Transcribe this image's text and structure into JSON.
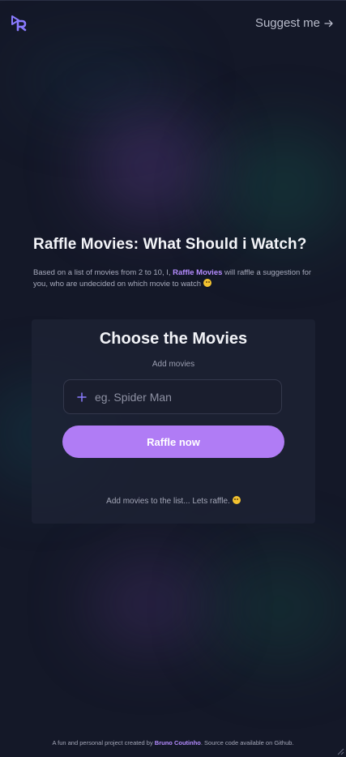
{
  "header": {
    "logo_icon": "raffle-logo",
    "suggest_label": "Suggest me",
    "arrow_icon": "arrow-right-icon"
  },
  "hero": {
    "title": "Raffle Movies: What Should i Watch?",
    "desc_before": "Based on a list of movies from 2 to 10, I, ",
    "brand": "Raffle Movies",
    "desc_after": " will raffle a suggestion for you, who are undecided on which movie to watch",
    "emoji": "grinning-face-emoji"
  },
  "card": {
    "title": "Choose the Movies",
    "add_label": "Add movies",
    "input_placeholder": "eg. Spider Man",
    "input_value": "",
    "plus_icon": "plus-icon",
    "button_label": "Raffle now",
    "empty_message": "Add movies to the list... Lets raffle.",
    "empty_emoji": "smiling-face-emoji"
  },
  "footer": {
    "text_before": "A fun and personal project created by ",
    "author": "Bruno Coutinho",
    "text_after": ". Source code available on Github."
  },
  "colors": {
    "background": "#141828",
    "accent": "#b07cf5",
    "brand_text": "#b58cff",
    "logo": "#8a7bff"
  }
}
